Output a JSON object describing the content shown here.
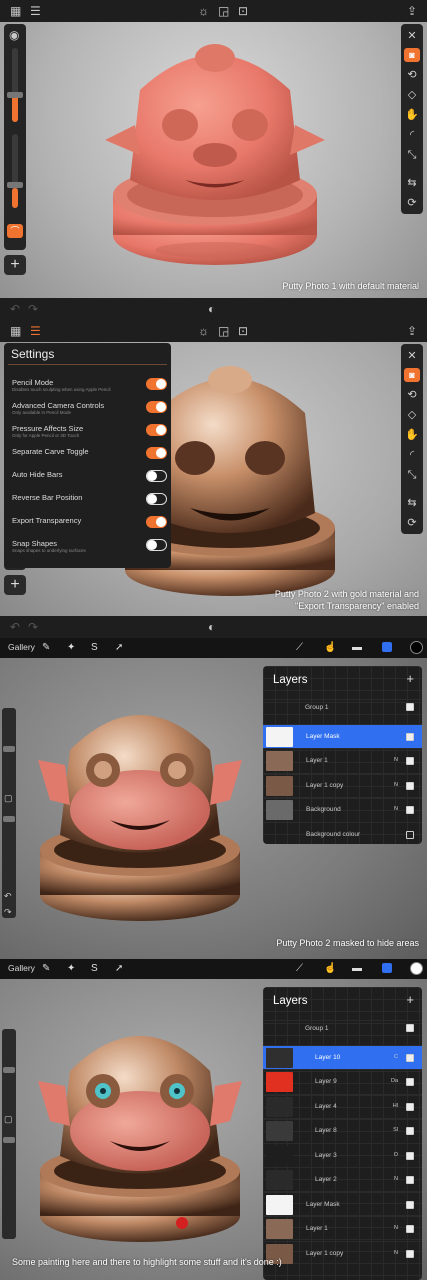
{
  "panel1": {
    "caption": "Putty Photo 1 with default material"
  },
  "panel2": {
    "settings_title": "Settings",
    "settings": [
      {
        "label": "Pencil Mode",
        "sub": "Disables touch sculpting when using Apple Pencil",
        "on": true
      },
      {
        "label": "Advanced Camera Controls",
        "sub": "Only available in Pencil Mode",
        "on": true
      },
      {
        "label": "Pressure Affects Size",
        "sub": "Only for Apple Pencil or 3D Touch",
        "on": true
      },
      {
        "label": "Separate Carve Toggle",
        "sub": "",
        "on": true
      },
      {
        "label": "Auto Hide Bars",
        "sub": "",
        "on": false
      },
      {
        "label": "Reverse Bar Position",
        "sub": "",
        "on": false
      },
      {
        "label": "Export Transparency",
        "sub": "",
        "on": true
      },
      {
        "label": "Snap Shapes",
        "sub": "Snaps shapes to underlying surfaces",
        "on": false
      }
    ],
    "caption_line1": "Putty Photo 2 with gold material and",
    "caption_line2": "\"Export Transparency\" enabled"
  },
  "panel3": {
    "gallery": "Gallery",
    "layers_title": "Layers",
    "layers": [
      {
        "name": "Group 1",
        "mode": "",
        "checked": true,
        "selected": false
      },
      {
        "name": "Layer Mask",
        "mode": "",
        "checked": true,
        "selected": true
      },
      {
        "name": "Layer 1",
        "mode": "N",
        "checked": true,
        "selected": false
      },
      {
        "name": "Layer 1 copy",
        "mode": "N",
        "checked": true,
        "selected": false
      },
      {
        "name": "Background",
        "mode": "N",
        "checked": true,
        "selected": false
      },
      {
        "name": "Background colour",
        "mode": "",
        "checked": false,
        "selected": false
      }
    ],
    "caption": "Putty Photo 2 masked to hide areas",
    "color_swatch": "#000000"
  },
  "panel4": {
    "gallery": "Gallery",
    "layers_title": "Layers",
    "layers": [
      {
        "name": "Group 1",
        "mode": "",
        "checked": true,
        "selected": false
      },
      {
        "name": "Layer 10",
        "mode": "C",
        "checked": true,
        "selected": true
      },
      {
        "name": "Layer 9",
        "mode": "Da",
        "checked": true,
        "selected": false
      },
      {
        "name": "Layer 4",
        "mode": "Hl",
        "checked": true,
        "selected": false
      },
      {
        "name": "Layer 8",
        "mode": "Sl",
        "checked": true,
        "selected": false
      },
      {
        "name": "Layer 3",
        "mode": "O",
        "checked": true,
        "selected": false
      },
      {
        "name": "Layer 2",
        "mode": "N",
        "checked": true,
        "selected": false
      },
      {
        "name": "Layer Mask",
        "mode": "",
        "checked": true,
        "selected": false
      },
      {
        "name": "Layer 1",
        "mode": "N",
        "checked": true,
        "selected": false
      },
      {
        "name": "Layer 1 copy",
        "mode": "N",
        "checked": true,
        "selected": false
      }
    ],
    "caption": "Some painting here and there to highlight some stuff and it's done :)",
    "color_swatch": "#ffffff"
  },
  "colors": {
    "accent": "#f07430",
    "selection_blue": "#2f6ff0",
    "putty_default": "#e8786a",
    "gold": "#c8906a"
  }
}
